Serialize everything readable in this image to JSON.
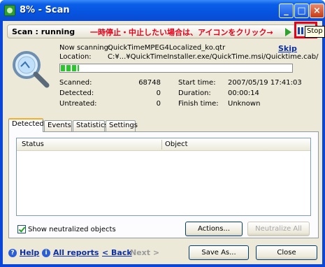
{
  "window": {
    "title": "8% - Scan",
    "min_label": "_",
    "max_label": "□",
    "close_label": "×"
  },
  "status": {
    "text": "Scan : running",
    "annotation": "一時停止・中止したい場合は、アイコンをクリック→",
    "tooltip": "Stop"
  },
  "scan": {
    "now_scanning_label": "Now scanning:",
    "now_scanning_value": "QuickTimeMPEG4Localized_ko.qtr",
    "location_label": "Location:",
    "location_value": "C:¥...¥QuickTimeInstaller.exe/QuickTime.msi/Quicktime.cab/",
    "skip_label": "Skip",
    "progress": 0.08
  },
  "stats": {
    "scanned_label": "Scanned:",
    "scanned_value": "68748",
    "detected_label": "Detected:",
    "detected_value": "0",
    "untreated_label": "Untreated:",
    "untreated_value": "0",
    "start_label": "Start time:",
    "start_value": "2007/05/19 17:41:03",
    "duration_label": "Duration:",
    "duration_value": "00:00:14",
    "finish_label": "Finish time:",
    "finish_value": "Unknown"
  },
  "tabs": [
    "Detected",
    "Events",
    "Statistics",
    "Settings"
  ],
  "list": {
    "columns": [
      "Status",
      "Object"
    ]
  },
  "options": {
    "show_neutralized_label": "Show neutralized objects",
    "show_neutralized_checked": true,
    "actions_label": "Actions...",
    "neutralize_all_label": "Neutralize All"
  },
  "footer": {
    "help_label": "Help",
    "all_reports_label": "All reports",
    "back_label": "< Back",
    "next_label": "Next >",
    "save_as_label": "Save As...",
    "close_label": "Close"
  },
  "colors": {
    "annotation": "#e8001a",
    "link": "#0b2fa8",
    "progress": "#28c828"
  }
}
